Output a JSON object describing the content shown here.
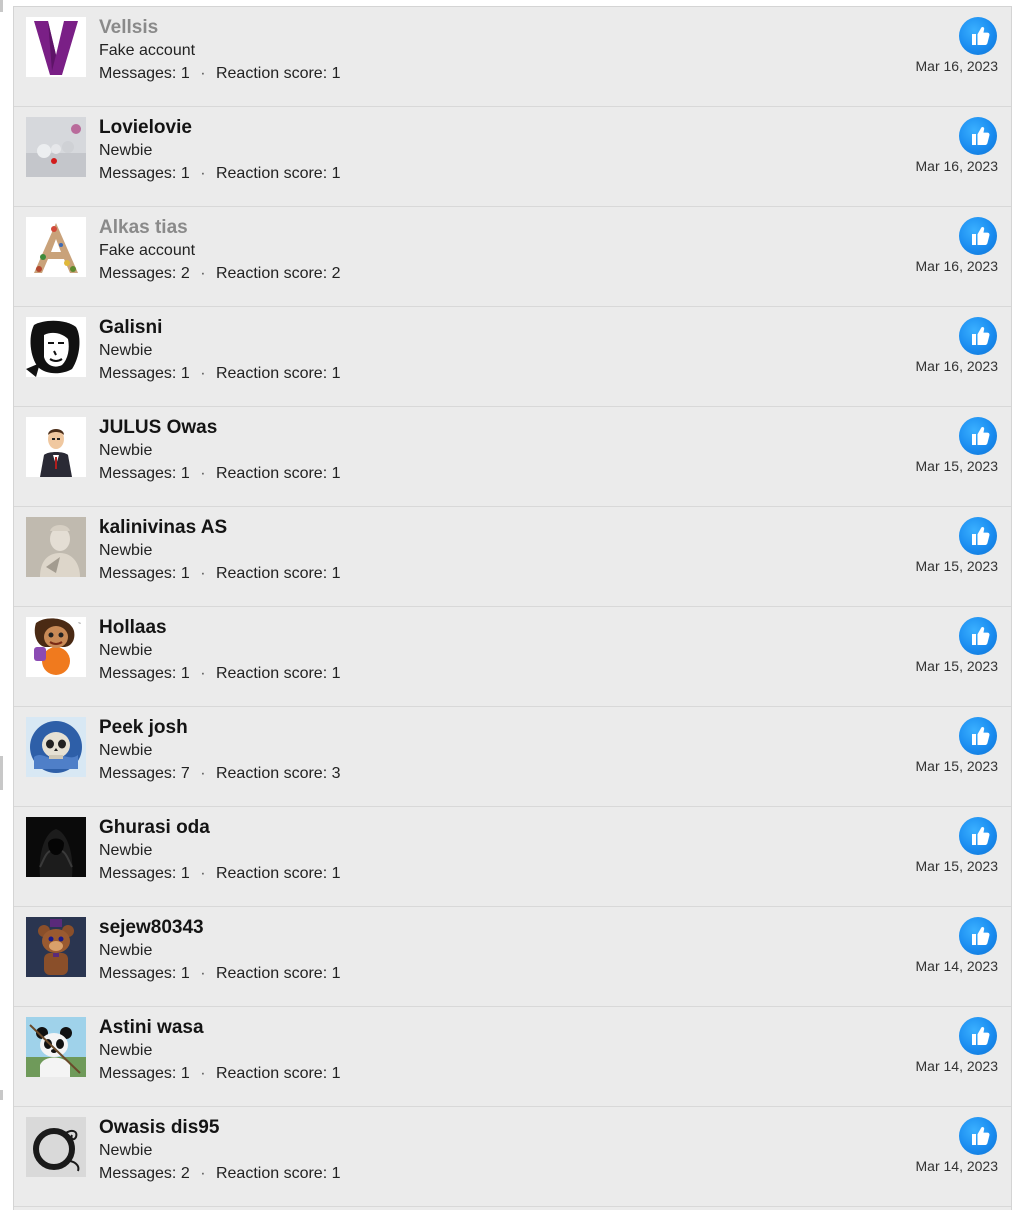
{
  "reactions": [
    {
      "username": "Vellsis",
      "fake": true,
      "title": "Fake account",
      "messages_label": "Messages:",
      "messages": "1",
      "score_label": "Reaction score:",
      "score": "1",
      "date": "Mar 16, 2023",
      "avatar": "purple-v-avatar",
      "reaction": "like-icon"
    },
    {
      "username": "Lovielovie",
      "fake": false,
      "title": "Newbie",
      "messages_label": "Messages:",
      "messages": "1",
      "score_label": "Reaction score:",
      "score": "1",
      "date": "Mar 16, 2023",
      "avatar": "grey-spheres-avatar",
      "reaction": "like-icon"
    },
    {
      "username": "Alkas tias",
      "fake": true,
      "title": "Fake account",
      "messages_label": "Messages:",
      "messages": "2",
      "score_label": "Reaction score:",
      "score": "2",
      "date": "Mar 16, 2023",
      "avatar": "floral-letter-a-avatar",
      "reaction": "like-icon"
    },
    {
      "username": "Galisni",
      "fake": false,
      "title": "Newbie",
      "messages_label": "Messages:",
      "messages": "1",
      "score_label": "Reaction score:",
      "score": "1",
      "date": "Mar 16, 2023",
      "avatar": "ink-portrait-avatar",
      "reaction": "like-icon"
    },
    {
      "username": "JULUS Owas",
      "fake": false,
      "title": "Newbie",
      "messages_label": "Messages:",
      "messages": "1",
      "score_label": "Reaction score:",
      "score": "1",
      "date": "Mar 15, 2023",
      "avatar": "cartoon-suit-man-avatar",
      "reaction": "like-icon"
    },
    {
      "username": "kalinivinas AS",
      "fake": false,
      "title": "Newbie",
      "messages_label": "Messages:",
      "messages": "1",
      "score_label": "Reaction score:",
      "score": "1",
      "date": "Mar 15, 2023",
      "avatar": "marble-statue-avatar",
      "reaction": "like-icon"
    },
    {
      "username": "Hollaas",
      "fake": false,
      "title": "Newbie",
      "messages_label": "Messages:",
      "messages": "1",
      "score_label": "Reaction score:",
      "score": "1",
      "date": "Mar 15, 2023",
      "avatar": "cartoon-girl-avatar",
      "reaction": "like-icon"
    },
    {
      "username": "Peek josh",
      "fake": false,
      "title": "Newbie",
      "messages_label": "Messages:",
      "messages": "7",
      "score_label": "Reaction score:",
      "score": "3",
      "date": "Mar 15, 2023",
      "avatar": "skull-globe-avatar",
      "reaction": "like-icon"
    },
    {
      "username": "Ghurasi oda",
      "fake": false,
      "title": "Newbie",
      "messages_label": "Messages:",
      "messages": "1",
      "score_label": "Reaction score:",
      "score": "1",
      "date": "Mar 15, 2023",
      "avatar": "hooded-figure-avatar",
      "reaction": "like-icon"
    },
    {
      "username": "sejew80343",
      "fake": false,
      "title": "Newbie",
      "messages_label": "Messages:",
      "messages": "1",
      "score_label": "Reaction score:",
      "score": "1",
      "date": "Mar 14, 2023",
      "avatar": "animatronic-bear-avatar",
      "reaction": "like-icon"
    },
    {
      "username": "Astini wasa",
      "fake": false,
      "title": "Newbie",
      "messages_label": "Messages:",
      "messages": "1",
      "score_label": "Reaction score:",
      "score": "1",
      "date": "Mar 14, 2023",
      "avatar": "panda-avatar",
      "reaction": "like-icon"
    },
    {
      "username": "Owasis dis95",
      "fake": false,
      "title": "Newbie",
      "messages_label": "Messages:",
      "messages": "2",
      "score_label": "Reaction score:",
      "score": "1",
      "date": "Mar 14, 2023",
      "avatar": "ornate-letter-o-avatar",
      "reaction": "like-icon"
    }
  ],
  "colors": {
    "like_blue": "#1a8cf0",
    "fake_name": "#8a8a8a",
    "row_background": "#ebebeb"
  }
}
